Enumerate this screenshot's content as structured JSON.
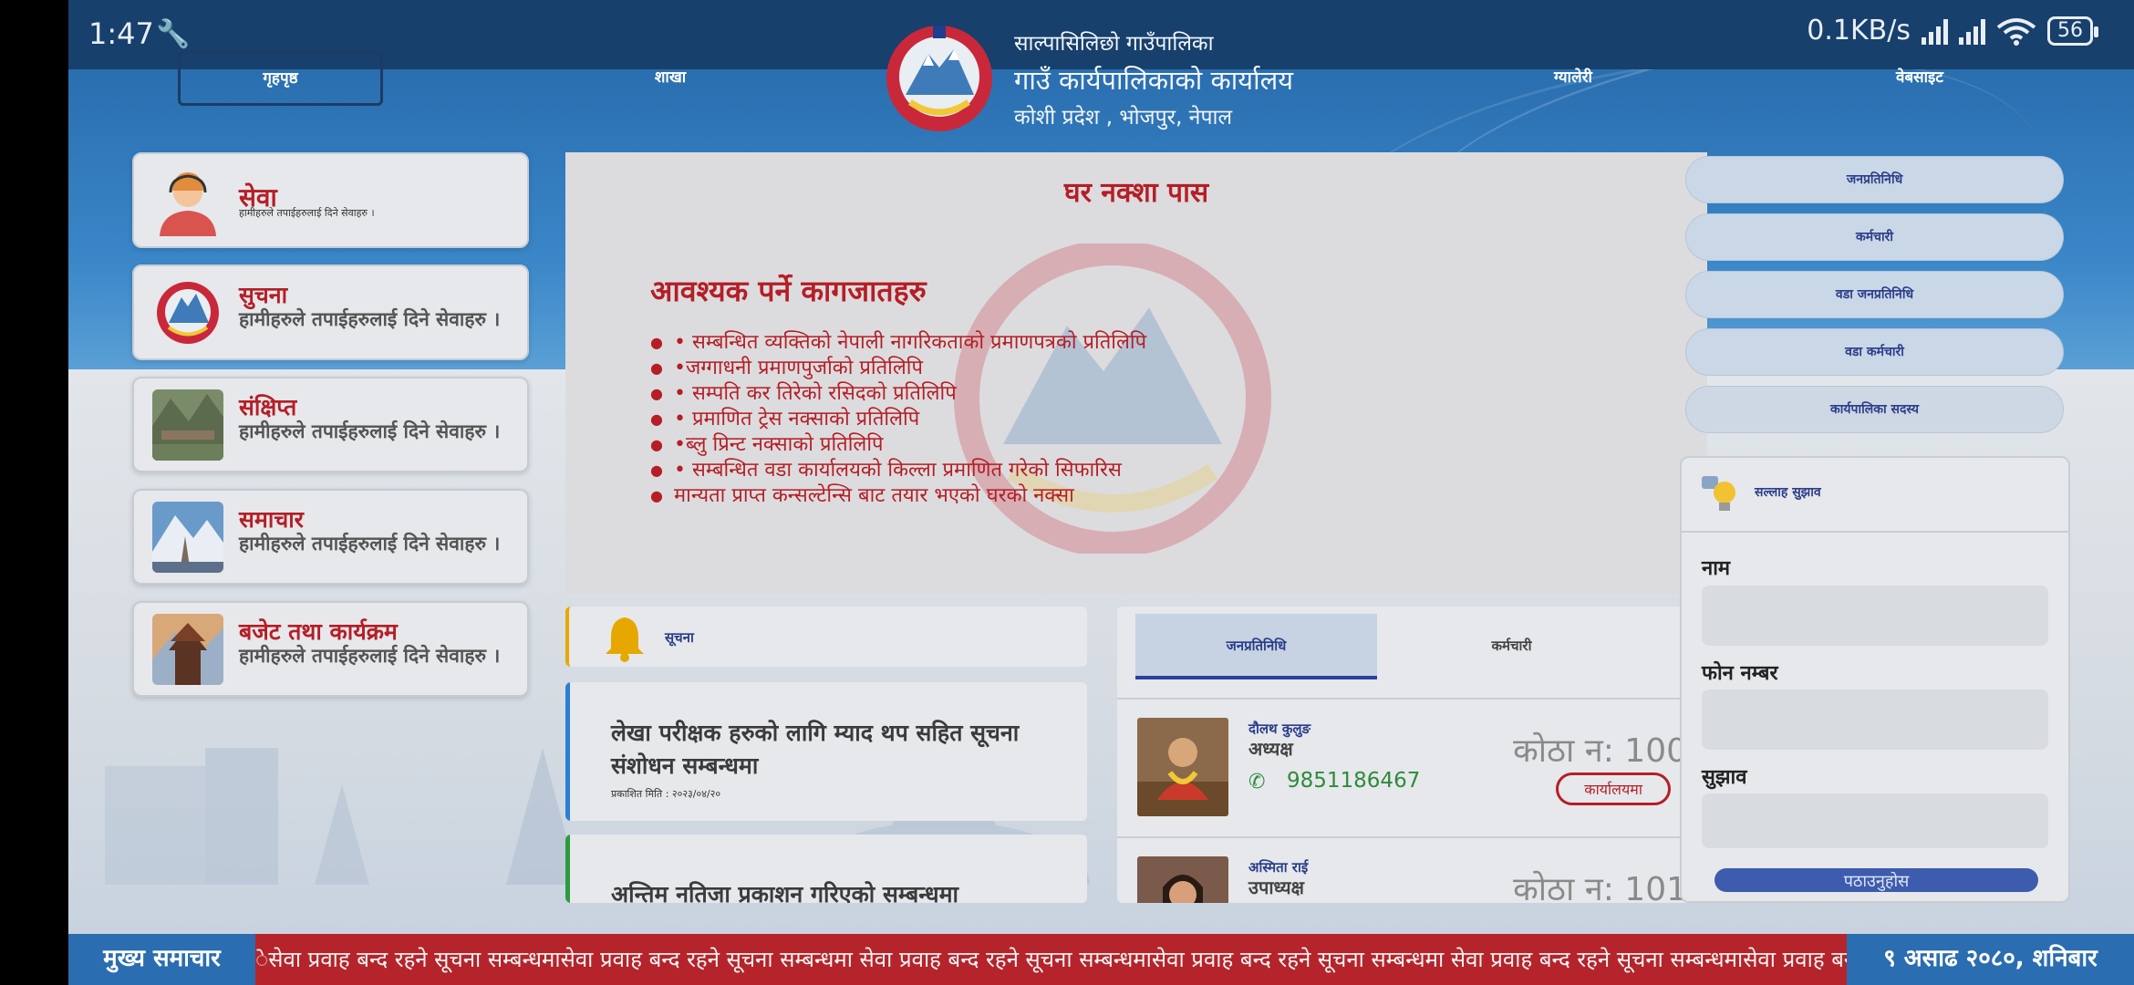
{
  "status_bar": {
    "time": "1:47",
    "net_speed": "0.1KB/s",
    "battery": "56"
  },
  "nav": {
    "home": "गृहपृष्ठ",
    "branch": "शाखा",
    "gallery": "ग्यालेरी",
    "website": "वेबसाइट"
  },
  "org": {
    "line1": "साल्पासिलिछो गाउँपालिका",
    "line2": "गाउँ कार्यपालिकाको कार्यालय",
    "line3": "कोशी प्रदेश , भोजपुर, नेपाल"
  },
  "left_cards": [
    {
      "title": "सेवा",
      "desc": "हामीहरुले तपाईहरुलाई दिने सेवाहरु ।"
    },
    {
      "title": "सुचना",
      "desc": "हामीहरुले तपाईहरुलाई दिने सेवाहरु ।"
    },
    {
      "title": "संक्षिप्त",
      "desc": "हामीहरुले तपाईहरुलाई दिने सेवाहरु ।"
    },
    {
      "title": "समाचार",
      "desc": "हामीहरुले तपाईहरुलाई दिने सेवाहरु ।"
    },
    {
      "title": "बजेट तथा कार्यक्रम",
      "desc": "हामीहरुले तपाईहरुलाई दिने सेवाहरु ।"
    }
  ],
  "main": {
    "title": "घर नक्शा पास",
    "subhead": "आवश्यक पर्ने कागजातहरु",
    "items": [
      "• सम्बन्धित व्यक्तिको नेपाली नागरिकताको प्रमाणपत्रको प्रतिलिपि",
      "•जग्गाधनी प्रमाणपुर्जाको प्रतिलिपि",
      "• सम्पति कर तिरेको रसिदको प्रतिलिपि",
      "• प्रमाणित ट्रेस नक्साको प्रतिलिपि",
      "•ब्लु प्रिन्ट नक्साको प्रतिलिपि",
      "• सम्बन्धित वडा कार्यालयको किल्ला प्रमाणित गरेको सिफारिस",
      " मान्यता प्राप्त कन्सल्टेन्सि बाट तयार भएको घरको नक्सा"
    ]
  },
  "notices": {
    "header": "सूचना",
    "items": [
      {
        "title": "लेखा परीक्षक हरुको लागि म्याद थप सहित सूचना संशोधन सम्बन्धमा",
        "date": "प्रकाशित मिति : २०२३/०४/२०",
        "color": "#2a7fd4"
      },
      {
        "title": "अन्तिम नतिजा प्रकाशन गरिएको सम्बन्धमा",
        "date": "",
        "color": "#2e9a3e"
      }
    ]
  },
  "representatives": {
    "tab_active": "जनप्रतिनिधि",
    "tab_other": "कर्मचारी",
    "rows": [
      {
        "name": "दौलथ कुलुङ",
        "role": "अध्यक्ष",
        "phone": "9851186467",
        "room": "कोठा न: 100",
        "office": "कार्यालयमा"
      },
      {
        "name": "अस्मिता राई",
        "role": "उपाध्यक्ष",
        "room": "कोठा न: 101"
      }
    ]
  },
  "right_menu": [
    "जनप्रतिनिधि",
    "कर्मचारी",
    "वडा जनप्रतिनिधि",
    "वडा कर्मचारी",
    "कार्यपालिका सदस्य"
  ],
  "suggestion": {
    "header": "सल्लाह सुझाव",
    "name_label": "नाम",
    "phone_label": "फोन नम्बर",
    "suggest_label": "सुझाव",
    "submit": "पठाउनुहोस"
  },
  "ticker": {
    "left": "मुख्य समाचार",
    "text": "ेसेवा प्रवाह बन्द रहने सूचना सम्बन्धमासेवा प्रवाह बन्द रहने सूचना सम्बन्धमा सेवा प्रवाह बन्द रहने सूचना सम्बन्धमासेवा प्रवाह बन्द रहने सूचना सम्बन्धमा सेवा प्रवाह बन्द रहने सूचना सम्बन्धमासेवा प्रवाह बन्द रहने",
    "right": "९ असाढ २०८०, शनिबार"
  }
}
